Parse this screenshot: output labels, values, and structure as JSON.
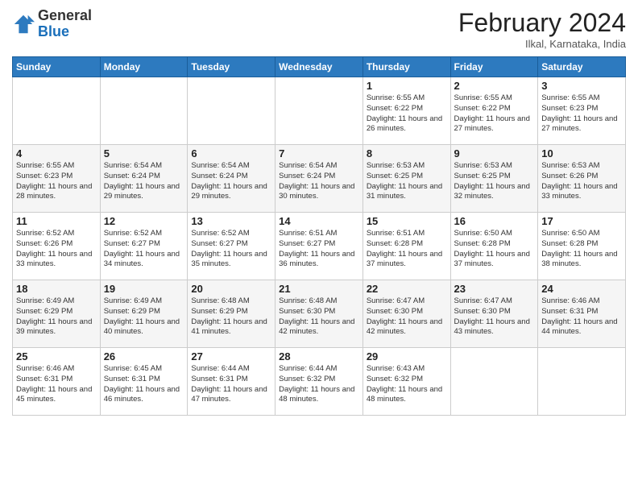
{
  "header": {
    "logo_line1": "General",
    "logo_line2": "Blue",
    "month_title": "February 2024",
    "location": "Ilkal, Karnataka, India"
  },
  "days_of_week": [
    "Sunday",
    "Monday",
    "Tuesday",
    "Wednesday",
    "Thursday",
    "Friday",
    "Saturday"
  ],
  "weeks": [
    [
      {
        "day": "",
        "info": ""
      },
      {
        "day": "",
        "info": ""
      },
      {
        "day": "",
        "info": ""
      },
      {
        "day": "",
        "info": ""
      },
      {
        "day": "1",
        "info": "Sunrise: 6:55 AM\nSunset: 6:22 PM\nDaylight: 11 hours\nand 26 minutes."
      },
      {
        "day": "2",
        "info": "Sunrise: 6:55 AM\nSunset: 6:22 PM\nDaylight: 11 hours\nand 27 minutes."
      },
      {
        "day": "3",
        "info": "Sunrise: 6:55 AM\nSunset: 6:23 PM\nDaylight: 11 hours\nand 27 minutes."
      }
    ],
    [
      {
        "day": "4",
        "info": "Sunrise: 6:55 AM\nSunset: 6:23 PM\nDaylight: 11 hours\nand 28 minutes."
      },
      {
        "day": "5",
        "info": "Sunrise: 6:54 AM\nSunset: 6:24 PM\nDaylight: 11 hours\nand 29 minutes."
      },
      {
        "day": "6",
        "info": "Sunrise: 6:54 AM\nSunset: 6:24 PM\nDaylight: 11 hours\nand 29 minutes."
      },
      {
        "day": "7",
        "info": "Sunrise: 6:54 AM\nSunset: 6:24 PM\nDaylight: 11 hours\nand 30 minutes."
      },
      {
        "day": "8",
        "info": "Sunrise: 6:53 AM\nSunset: 6:25 PM\nDaylight: 11 hours\nand 31 minutes."
      },
      {
        "day": "9",
        "info": "Sunrise: 6:53 AM\nSunset: 6:25 PM\nDaylight: 11 hours\nand 32 minutes."
      },
      {
        "day": "10",
        "info": "Sunrise: 6:53 AM\nSunset: 6:26 PM\nDaylight: 11 hours\nand 33 minutes."
      }
    ],
    [
      {
        "day": "11",
        "info": "Sunrise: 6:52 AM\nSunset: 6:26 PM\nDaylight: 11 hours\nand 33 minutes."
      },
      {
        "day": "12",
        "info": "Sunrise: 6:52 AM\nSunset: 6:27 PM\nDaylight: 11 hours\nand 34 minutes."
      },
      {
        "day": "13",
        "info": "Sunrise: 6:52 AM\nSunset: 6:27 PM\nDaylight: 11 hours\nand 35 minutes."
      },
      {
        "day": "14",
        "info": "Sunrise: 6:51 AM\nSunset: 6:27 PM\nDaylight: 11 hours\nand 36 minutes."
      },
      {
        "day": "15",
        "info": "Sunrise: 6:51 AM\nSunset: 6:28 PM\nDaylight: 11 hours\nand 37 minutes."
      },
      {
        "day": "16",
        "info": "Sunrise: 6:50 AM\nSunset: 6:28 PM\nDaylight: 11 hours\nand 37 minutes."
      },
      {
        "day": "17",
        "info": "Sunrise: 6:50 AM\nSunset: 6:28 PM\nDaylight: 11 hours\nand 38 minutes."
      }
    ],
    [
      {
        "day": "18",
        "info": "Sunrise: 6:49 AM\nSunset: 6:29 PM\nDaylight: 11 hours\nand 39 minutes."
      },
      {
        "day": "19",
        "info": "Sunrise: 6:49 AM\nSunset: 6:29 PM\nDaylight: 11 hours\nand 40 minutes."
      },
      {
        "day": "20",
        "info": "Sunrise: 6:48 AM\nSunset: 6:29 PM\nDaylight: 11 hours\nand 41 minutes."
      },
      {
        "day": "21",
        "info": "Sunrise: 6:48 AM\nSunset: 6:30 PM\nDaylight: 11 hours\nand 42 minutes."
      },
      {
        "day": "22",
        "info": "Sunrise: 6:47 AM\nSunset: 6:30 PM\nDaylight: 11 hours\nand 42 minutes."
      },
      {
        "day": "23",
        "info": "Sunrise: 6:47 AM\nSunset: 6:30 PM\nDaylight: 11 hours\nand 43 minutes."
      },
      {
        "day": "24",
        "info": "Sunrise: 6:46 AM\nSunset: 6:31 PM\nDaylight: 11 hours\nand 44 minutes."
      }
    ],
    [
      {
        "day": "25",
        "info": "Sunrise: 6:46 AM\nSunset: 6:31 PM\nDaylight: 11 hours\nand 45 minutes."
      },
      {
        "day": "26",
        "info": "Sunrise: 6:45 AM\nSunset: 6:31 PM\nDaylight: 11 hours\nand 46 minutes."
      },
      {
        "day": "27",
        "info": "Sunrise: 6:44 AM\nSunset: 6:31 PM\nDaylight: 11 hours\nand 47 minutes."
      },
      {
        "day": "28",
        "info": "Sunrise: 6:44 AM\nSunset: 6:32 PM\nDaylight: 11 hours\nand 48 minutes."
      },
      {
        "day": "29",
        "info": "Sunrise: 6:43 AM\nSunset: 6:32 PM\nDaylight: 11 hours\nand 48 minutes."
      },
      {
        "day": "",
        "info": ""
      },
      {
        "day": "",
        "info": ""
      }
    ]
  ]
}
